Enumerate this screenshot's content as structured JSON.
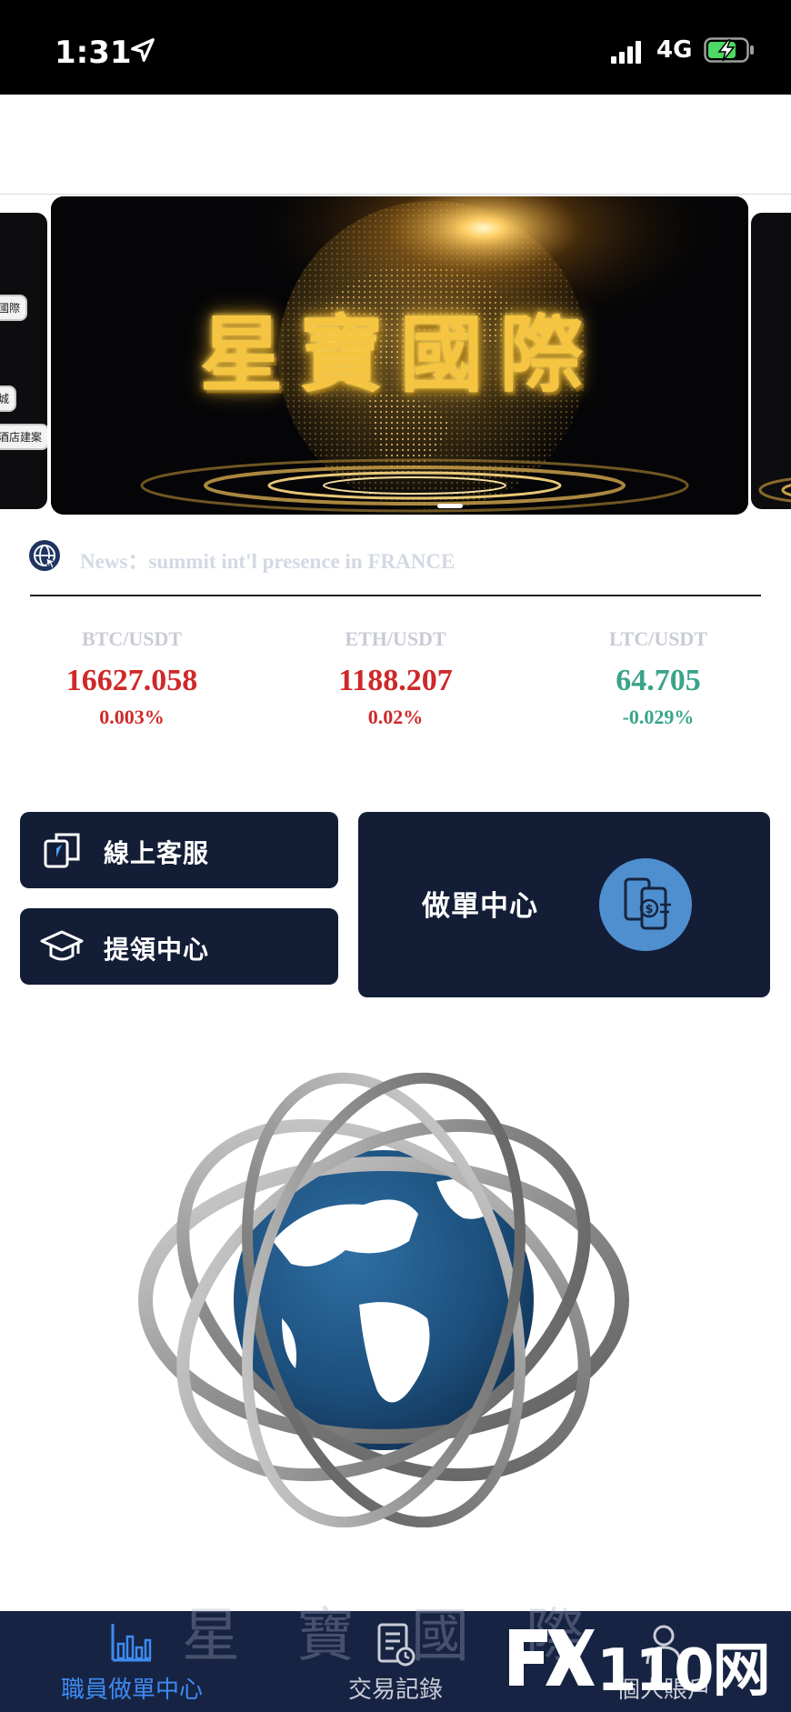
{
  "status_bar": {
    "time": "1:31",
    "network": "4G",
    "location_icon": "location-arrow-icon",
    "signal_icon": "signal-bars-icon",
    "battery_icon": "battery-charging-icon"
  },
  "banner": {
    "title": "星寶國際",
    "left_peek_labels": [
      "國際",
      "城",
      "酒店建案"
    ]
  },
  "news": {
    "icon": "globe-news-icon",
    "text": "News：summit int'l presence in FRANCE"
  },
  "tickers": [
    {
      "symbol": "BTC/USDT",
      "price": "16627.058",
      "change": "0.003%",
      "trend": "up"
    },
    {
      "symbol": "ETH/USDT",
      "price": "1188.207",
      "change": "0.02%",
      "trend": "up"
    },
    {
      "symbol": "LTC/USDT",
      "price": "64.705",
      "change": "-0.029%",
      "trend": "down"
    }
  ],
  "actions": {
    "customer_service": "線上客服",
    "withdraw_center": "提領中心",
    "order_center": "做單中心"
  },
  "bottom_nav": {
    "ghost_text": "星寶國際",
    "items": [
      {
        "label": "職員做單中心",
        "icon": "bar-chart-icon",
        "active": true
      },
      {
        "label": "交易記錄",
        "icon": "document-clock-icon",
        "active": false
      },
      {
        "label": "個人賬戶",
        "icon": "user-icon",
        "active": false
      }
    ]
  },
  "watermark": {
    "text": "FX110网",
    "number": "110网"
  },
  "colors": {
    "card_bg": "#131d36",
    "nav_bg": "#172342",
    "up": "#cf2929",
    "down": "#3aa48a",
    "nav_active": "#3d8bf2",
    "banner_gold": "#f5c542"
  }
}
